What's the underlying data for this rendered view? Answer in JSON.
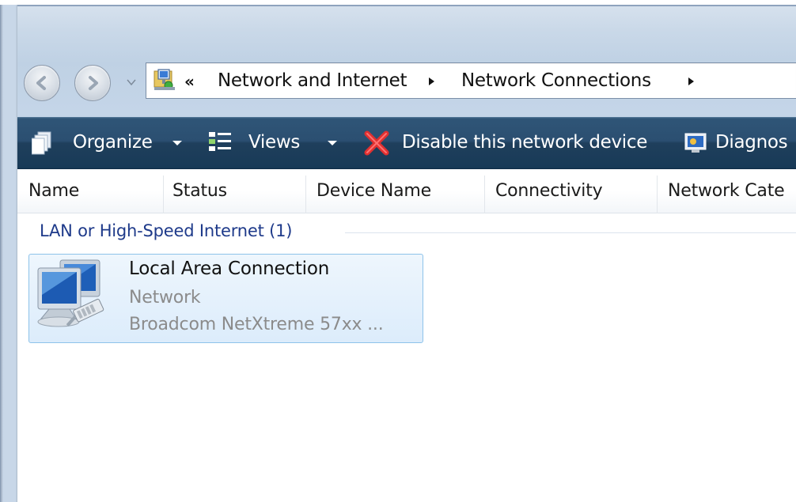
{
  "address_bar": {
    "overflow_glyph": "«",
    "crumbs": [
      {
        "label": "Network and Internet"
      },
      {
        "label": "Network Connections"
      }
    ]
  },
  "toolbar": {
    "organize_label": "Organize",
    "views_label": "Views",
    "disable_label": "Disable this network device",
    "diagnose_label": "Diagnos"
  },
  "columns": [
    {
      "label": "Name"
    },
    {
      "label": "Status"
    },
    {
      "label": "Device Name"
    },
    {
      "label": "Connectivity"
    },
    {
      "label": "Network Cate"
    }
  ],
  "group": {
    "label": "LAN or High-Speed Internet (1)"
  },
  "connection": {
    "name": "Local Area Connection",
    "status": "Network",
    "device": "Broadcom NetXtreme 57xx ..."
  },
  "icons": {
    "back": "back-arrow-icon",
    "forward": "forward-arrow-icon",
    "recent_pages": "chevron-down-icon",
    "location": "network-connections-folder-icon",
    "organize": "organize-icon",
    "views": "views-icon",
    "disable": "red-x-icon",
    "diagnose": "diagnose-icon",
    "connection": "network-computer-icon"
  },
  "colors": {
    "toolbar": "#2b4f71",
    "group_header_text": "#1e3a8a",
    "selected_tile": "#dcecfb",
    "selected_tile_border": "#8ec3ea",
    "disable_icon": "#e03030"
  }
}
